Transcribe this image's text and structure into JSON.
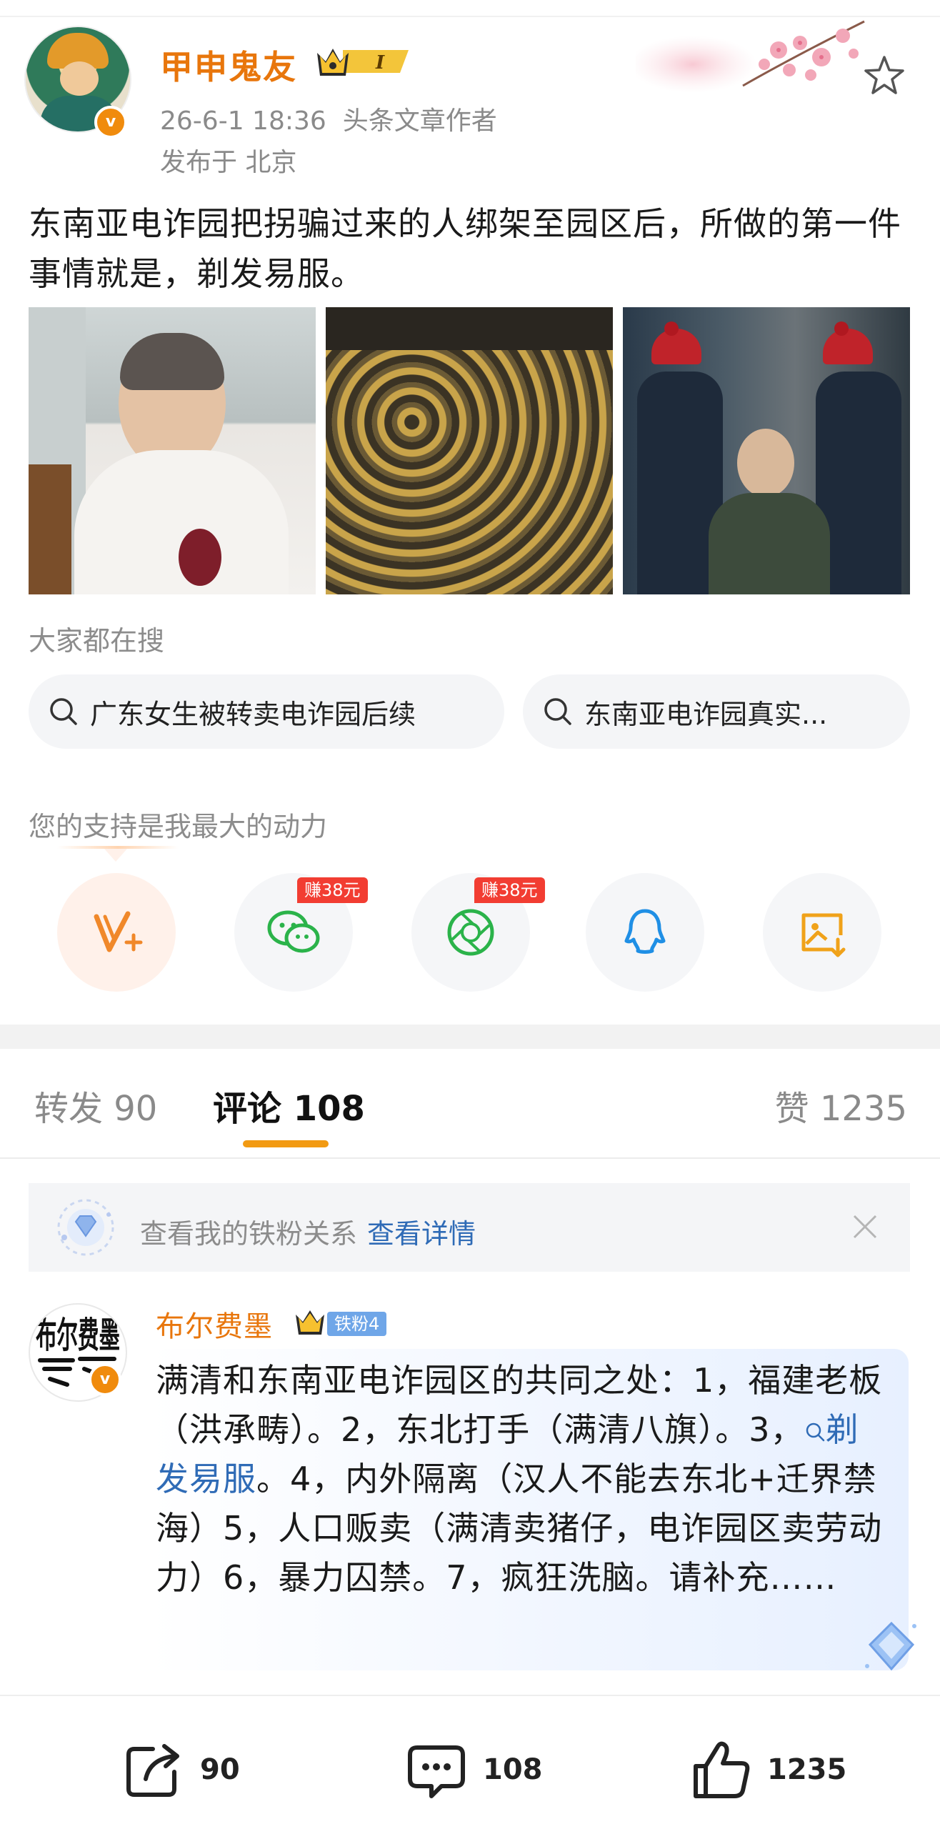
{
  "author": {
    "name": "甲申鬼友",
    "level": "I",
    "time": "26-6-1 18:36",
    "role": "头条文章作者",
    "location": "发布于 北京"
  },
  "post": {
    "text": "东南亚电诈园把拐骗过来的人绑架至园区后，所做的第一件事情就是，剃发易服。"
  },
  "search": {
    "title": "大家都在搜",
    "chips": [
      "广东女生被转卖电诈园后续",
      "东南亚电诈园真实..."
    ]
  },
  "support": {
    "title": "您的支持是我最大的动力",
    "earn_badge_1": "赚38元",
    "earn_badge_2": "赚38元"
  },
  "tabs": {
    "repost": "转发 90",
    "comment": "评论 108",
    "like": "赞 1235"
  },
  "fan_bar": {
    "text": "查看我的铁粉关系",
    "link": "查看详情"
  },
  "comment": {
    "name": "布尔费墨",
    "fan_badge": "铁粉4",
    "avatar_text": "布尔费墨",
    "text_before": "满清和东南亚电诈园区的共同之处：1，福建老板（洪承畴）。2，东北打手（满清八旗）。3，",
    "link": "剃发易服",
    "text_after": "。4，内外隔离（汉人不能去东北+迁界禁海）5，人口贩卖（满清卖猪仔，电诈园区卖劳动力）6，暴力囚禁。7，疯狂洗脑。请补充……"
  },
  "actions": {
    "repost_count": "90",
    "comment_count": "108",
    "like_count": "1235"
  },
  "colors": {
    "accent": "#e8760c",
    "link": "#2f6bb6",
    "tab_underline": "#f29a12",
    "earn": "#f23d32"
  }
}
